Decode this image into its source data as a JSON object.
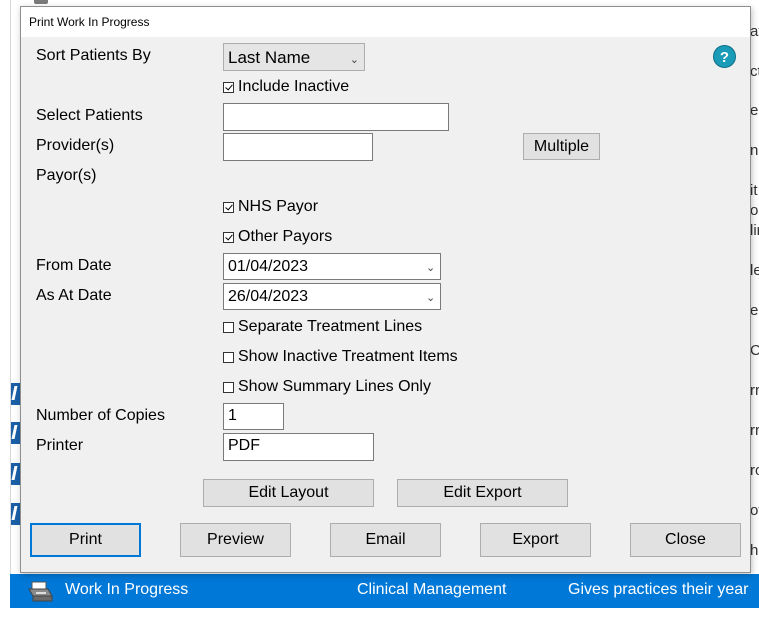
{
  "dialog": {
    "title": "Print Work In Progress",
    "help_icon": "?",
    "labels": {
      "sort_by": "Sort Patients By",
      "select_patients": "Select Patients",
      "providers": "Provider(s)",
      "payors": "Payor(s)",
      "from_date": "From Date",
      "as_at_date": "As At Date",
      "copies": "Number of Copies",
      "printer": "Printer"
    },
    "sort_by": {
      "value": "Last Name"
    },
    "checkboxes": {
      "include_inactive": {
        "label": "Include Inactive",
        "checked": true
      },
      "nhs_payor": {
        "label": "NHS Payor",
        "checked": true
      },
      "other_payors": {
        "label": "Other Payors",
        "checked": true
      },
      "separate_treatment_lines": {
        "label": "Separate Treatment Lines",
        "checked": false
      },
      "show_inactive_items": {
        "label": "Show Inactive Treatment Items",
        "checked": false
      },
      "summary_lines_only": {
        "label": "Show Summary Lines Only",
        "checked": false
      }
    },
    "fields": {
      "select_patients": "",
      "providers": "",
      "from_date": "01/04/2023",
      "as_at_date": "26/04/2023",
      "copies": "1",
      "printer": "PDF"
    },
    "buttons": {
      "multiple": "Multiple",
      "edit_layout": "Edit Layout",
      "edit_export": "Edit Export",
      "print": "Print",
      "preview": "Preview",
      "email": "Email",
      "export": "Export",
      "close": "Close"
    }
  },
  "background": {
    "row": {
      "name": "Work In Progress",
      "category": "Clinical Management",
      "description": "Gives practices their year"
    },
    "right_fragments": [
      "at",
      "ct",
      "e",
      "n",
      "it",
      "on",
      "lin",
      "le",
      "e",
      "Co",
      "rr",
      "rr",
      "ro",
      "ov",
      "he"
    ]
  }
}
